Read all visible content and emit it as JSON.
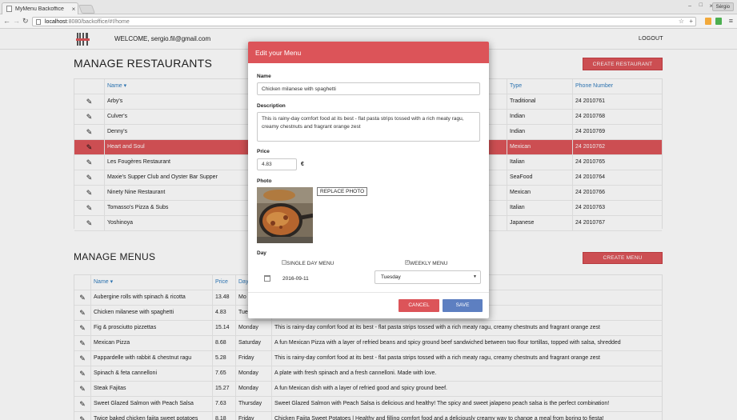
{
  "browser": {
    "tab_title": "MyMenu Backoffice",
    "tab_close": "×",
    "url_host": "localhost",
    "url_path": ":8080/backoffice/#!/home",
    "user_badge": "Sérgio",
    "back_icon": "arrow-left-icon",
    "forward_icon": "arrow-right-icon",
    "reload_icon": "reload-icon",
    "star_icon": "star-icon",
    "menu_icon": "hamburger-icon"
  },
  "header": {
    "welcome": "WELCOME, sergio.fil@gmail.com",
    "logout": "LOGOUT",
    "logo_icon": "fork-knife-icon"
  },
  "restaurants": {
    "title": "MANAGE RESTAURANTS",
    "create_label": "CREATE RESTAURANT",
    "columns": {
      "name": "Name ▾",
      "type": "Type",
      "phone": "Phone Number"
    },
    "rows": [
      {
        "name": "Arby's",
        "type": "Traditional",
        "phone": "24 2010761"
      },
      {
        "name": "Culver's",
        "type": "Indian",
        "phone": "24 2010768"
      },
      {
        "name": "Denny's",
        "type": "Indian",
        "phone": "24 2010769"
      },
      {
        "name": "Heart and Soul",
        "type": "Mexican",
        "phone": "24 2010762"
      },
      {
        "name": "Les Fougères Restaurant",
        "type": "Italian",
        "phone": "24 2010765"
      },
      {
        "name": "Maxie's Supper Club and Oyster Bar Supper",
        "type": "SeaFood",
        "phone": "24 2010764"
      },
      {
        "name": "Ninety Nine Restaurant",
        "type": "Mexican",
        "phone": "24 2010766"
      },
      {
        "name": "Tomasso's Pizza & Subs",
        "type": "Italian",
        "phone": "24 2010763"
      },
      {
        "name": "Yoshinoya",
        "type": "Japanese",
        "phone": "24 2010767"
      }
    ],
    "selected_row": "Heart and Soul"
  },
  "menus": {
    "title": "MANAGE MENUS",
    "create_label": "CREATE MENU",
    "columns": {
      "name": "Name ▾",
      "price": "Price",
      "day": "Day",
      "description": ""
    },
    "rows": [
      {
        "name": "Aubergine rolls with spinach & ricotta",
        "price": "13.48",
        "day": "Mo",
        "description": "ke"
      },
      {
        "name": "Chicken milanese with spaghetti",
        "price": "4.83",
        "day": "Tue",
        "description": ", creamy chestnuts and fragrant orange zest"
      },
      {
        "name": "Fig & prosciutto pizzettas",
        "price": "15.14",
        "day": "Monday",
        "description": "This is rainy-day comfort food at its best - flat pasta strips tossed with a rich meaty ragu, creamy chestnuts and fragrant orange zest"
      },
      {
        "name": "Mexican Pizza",
        "price": "8.68",
        "day": "Saturday",
        "description": "A fun Mexican Pizza with a layer of refried beans and spicy ground beef sandwiched between two flour tortillas, topped with salsa, shredded"
      },
      {
        "name": "Pappardelle with rabbit & chestnut ragu",
        "price": "5.28",
        "day": "Friday",
        "description": "This is rainy-day comfort food at its best - flat pasta strips tossed with a rich meaty ragu, creamy chestnuts and fragrant orange zest"
      },
      {
        "name": "Spinach & feta cannelloni",
        "price": "7.65",
        "day": "Monday",
        "description": "A plate with fresh spinach and a fresh cannelloni. Made with love."
      },
      {
        "name": "Steak Fajitas",
        "price": "15.27",
        "day": "Monday",
        "description": "A fun Mexican dish with a layer of refried good and spicy ground beef."
      },
      {
        "name": "Sweet Glazed Salmon with Peach Salsa",
        "price": "7.63",
        "day": "Thursday",
        "description": "Sweet Glazed Salmon with Peach Salsa is delicious and healthy! The spicy and sweet jalapeno peach salsa is the perfect combination!"
      },
      {
        "name": "Twice baked chicken fajita sweet potatoes",
        "price": "8.18",
        "day": "Friday",
        "description": "Chicken Fajita Sweet Potatoes | Healthy and filling comfort food and a deliciously creamy way to change a meal from boring to fiesta!"
      }
    ]
  },
  "modal": {
    "title": "Edit your Menu",
    "name_label": "Name",
    "name_value": "Chicken milanese with spaghetti",
    "description_label": "Description",
    "description_value": "This is rainy-day comfort food at its best - flat pasta strips tossed with a rich meaty ragu, creamy chestnuts and fragrant orange zest",
    "price_label": "Price",
    "price_value": "4.83",
    "currency": "€",
    "photo_label": "Photo",
    "replace_photo": "REPLACE PHOTO",
    "day_label": "Day",
    "single_day": "SINGLE DAY MENU",
    "weekly": "WEEKLY MENU",
    "single_day_checked": false,
    "weekly_checked": true,
    "date_value": "2016-09-11",
    "day_select": "Tuesday",
    "cancel": "CANCEL",
    "save": "SAVE"
  },
  "colors": {
    "accent": "#dc5459",
    "save": "#5d7fc1",
    "link": "#2f7bbd"
  }
}
